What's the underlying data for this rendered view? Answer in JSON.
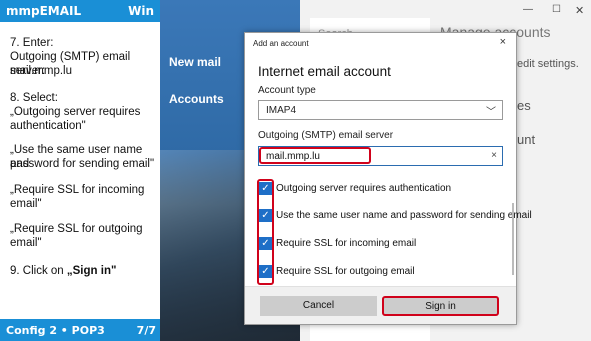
{
  "left_panel": {
    "header_title": "mmpEMAIL",
    "header_right": "Win",
    "steps": {
      "s7a": "7.    Enter:",
      "s7b": "Outgoing (SMTP) email server:",
      "s7c": "mail.mmp.lu",
      "s8a": "8.    Select:",
      "s8b": "„Outgoing server requires",
      "s8c": "authentication\"",
      "s8d": "„Use the same user name and",
      "s8e": "password for sending email\"",
      "s8f": "„Require SSL for incoming",
      "s8g": "email\"",
      "s8h": "„Require SSL for outgoing",
      "s8i": "email\"",
      "s9a": "9.    Click on ",
      "s9b": "„Sign in\""
    },
    "footer_left": "Config 2 • POP3",
    "footer_right": "7/7"
  },
  "app_nav": {
    "new_mail": "New mail",
    "accounts": "Accounts"
  },
  "background": {
    "search_stub": "Search",
    "manage_accounts": "Manage accounts",
    "edit_settings": "edit settings.",
    "es_fragment": "es",
    "unt_fragment": "unt"
  },
  "dialog": {
    "title": "Add an account",
    "close": "×",
    "heading": "Internet email account",
    "account_type_label": "Account type",
    "account_type_value": "IMAP4",
    "smtp_label": "Outgoing (SMTP) email server",
    "smtp_value": "mail.mmp.lu",
    "clear_icon": "×",
    "checkboxes": [
      {
        "label": "Outgoing server requires authentication",
        "checked": true
      },
      {
        "label": "Use the same user name and password for sending email",
        "checked": true
      },
      {
        "label": "Require SSL for incoming email",
        "checked": true
      },
      {
        "label": "Require SSL for outgoing email",
        "checked": true
      }
    ],
    "cancel_label": "Cancel",
    "signin_label": "Sign in"
  },
  "colors": {
    "accent_blue": "#1a8fd6",
    "highlight_red": "#d0021b",
    "checkbox_blue": "#1e6fc7"
  }
}
